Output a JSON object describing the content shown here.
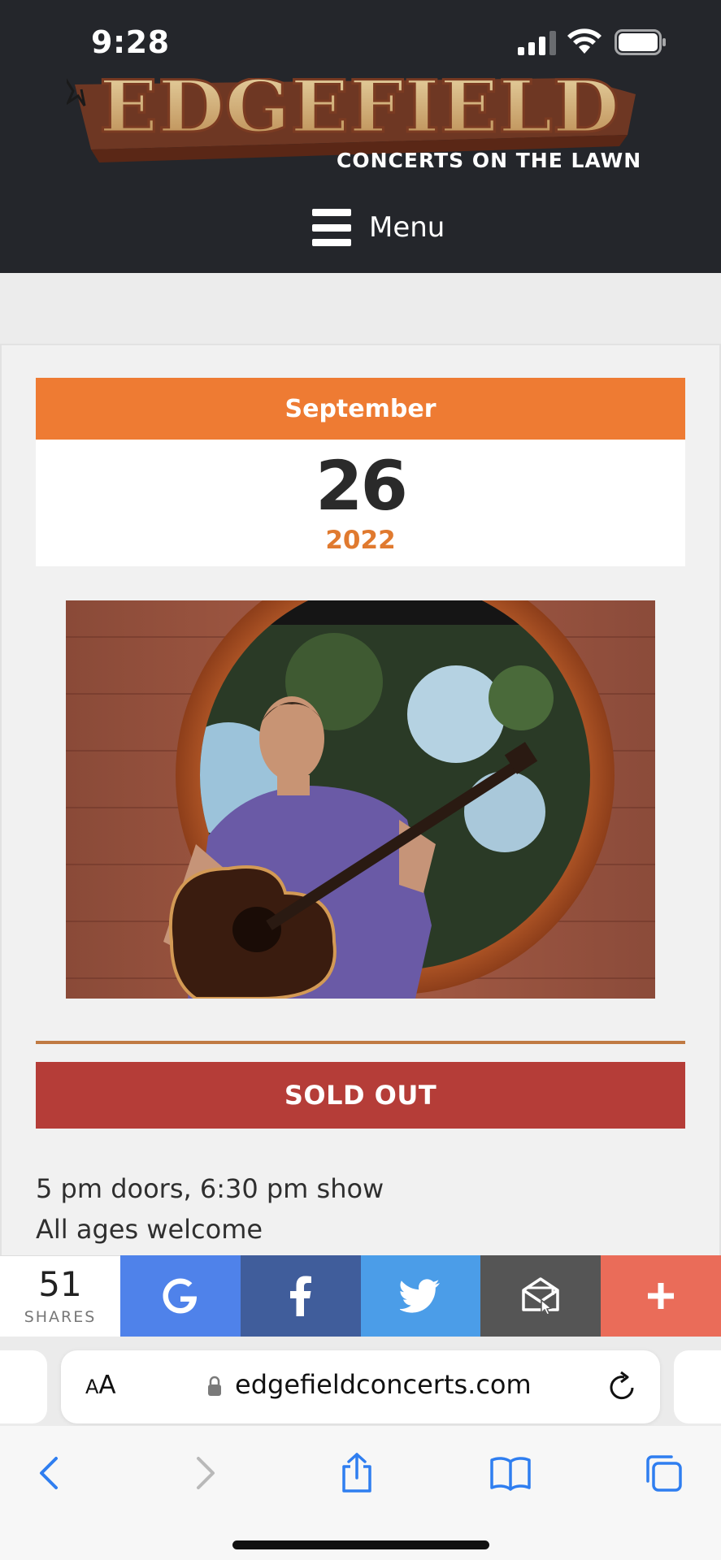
{
  "status_bar": {
    "time": "9:28"
  },
  "header": {
    "logo_text": "EDGEFIELD",
    "tagline": "CONCERTS ON THE LAWN",
    "menu_label": "Menu"
  },
  "event": {
    "month": "September",
    "day": "26",
    "year": "2022",
    "ticket_status": "SOLD OUT",
    "info_lines": [
      "5 pm doors, 6:30 pm show",
      "All ages welcome"
    ]
  },
  "share_bar": {
    "count": "51",
    "count_label": "SHARES",
    "buttons": [
      "google-icon",
      "facebook-icon",
      "twitter-icon",
      "email-icon",
      "plus-icon"
    ]
  },
  "browser": {
    "text_size_small": "A",
    "text_size_big": "A",
    "url": "edgefieldconcerts.com"
  },
  "colors": {
    "header_bg": "#24262b",
    "month_orange": "#ee7b33",
    "sold_out_red": "#b53d38",
    "google_blue": "#4f82ea",
    "facebook_blue": "#405d9b",
    "twitter_blue": "#4b9de8",
    "email_gray": "#555555",
    "more_coral": "#ea6c59"
  }
}
